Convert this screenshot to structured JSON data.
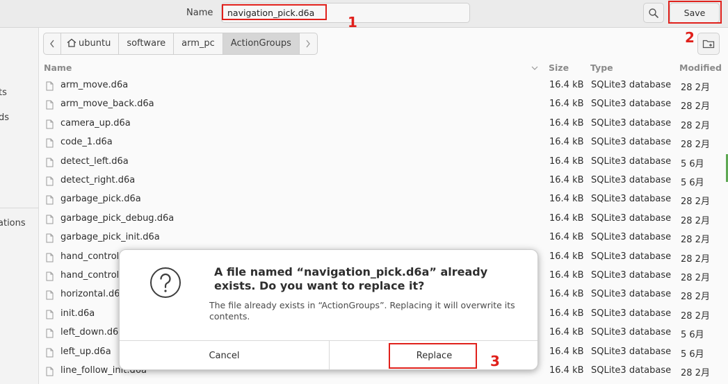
{
  "header": {
    "name_label": "Name",
    "filename_value": "navigation_pick.d6a",
    "save_label": "Save"
  },
  "sidebar": {
    "items": [
      {
        "label": "ts"
      },
      {
        "label": "ds"
      },
      {
        "label": "ations"
      }
    ]
  },
  "breadcrumb": {
    "items": [
      {
        "label": "ubuntu"
      },
      {
        "label": "software"
      },
      {
        "label": "arm_pc"
      },
      {
        "label": "ActionGroups"
      }
    ]
  },
  "columns": {
    "name": "Name",
    "size": "Size",
    "type": "Type",
    "modified": "Modified"
  },
  "files": [
    {
      "name": "arm_move.d6a",
      "size": "16.4 kB",
      "type": "SQLite3 database",
      "modified": "28 2月"
    },
    {
      "name": "arm_move_back.d6a",
      "size": "16.4 kB",
      "type": "SQLite3 database",
      "modified": "28 2月"
    },
    {
      "name": "camera_up.d6a",
      "size": "16.4 kB",
      "type": "SQLite3 database",
      "modified": "28 2月"
    },
    {
      "name": "code_1.d6a",
      "size": "16.4 kB",
      "type": "SQLite3 database",
      "modified": "28 2月"
    },
    {
      "name": "detect_left.d6a",
      "size": "16.4 kB",
      "type": "SQLite3 database",
      "modified": "5 6月"
    },
    {
      "name": "detect_right.d6a",
      "size": "16.4 kB",
      "type": "SQLite3 database",
      "modified": "5 6月"
    },
    {
      "name": "garbage_pick.d6a",
      "size": "16.4 kB",
      "type": "SQLite3 database",
      "modified": "28 2月"
    },
    {
      "name": "garbage_pick_debug.d6a",
      "size": "16.4 kB",
      "type": "SQLite3 database",
      "modified": "28 2月"
    },
    {
      "name": "garbage_pick_init.d6a",
      "size": "16.4 kB",
      "type": "SQLite3 database",
      "modified": "28 2月"
    },
    {
      "name": "hand_control",
      "size": "16.4 kB",
      "type": "SQLite3 database",
      "modified": "28 2月"
    },
    {
      "name": "hand_control",
      "size": "16.4 kB",
      "type": "SQLite3 database",
      "modified": "28 2月"
    },
    {
      "name": "horizontal.d6",
      "size": "16.4 kB",
      "type": "SQLite3 database",
      "modified": "28 2月"
    },
    {
      "name": "init.d6a",
      "size": "16.4 kB",
      "type": "SQLite3 database",
      "modified": "28 2月"
    },
    {
      "name": "left_down.d6",
      "size": "16.4 kB",
      "type": "SQLite3 database",
      "modified": "5 6月"
    },
    {
      "name": "left_up.d6a",
      "size": "16.4 kB",
      "type": "SQLite3 database",
      "modified": "5 6月"
    },
    {
      "name": "line_follow_init.d6a",
      "size": "16.4 kB",
      "type": "SQLite3 database",
      "modified": "28 2月"
    }
  ],
  "dialog": {
    "title": "A file named “navigation_pick.d6a” already exists.  Do you want to replace it?",
    "body": "The file already exists in “ActionGroups”.  Replacing it will overwrite its contents.",
    "cancel_label": "Cancel",
    "replace_label": "Replace"
  },
  "annotations": {
    "step1": "1",
    "step2": "2",
    "step3": "3"
  },
  "colors": {
    "annotation": "#e0201b",
    "dialog_bg": "#ffffff",
    "header_bg": "#ebebeb"
  }
}
